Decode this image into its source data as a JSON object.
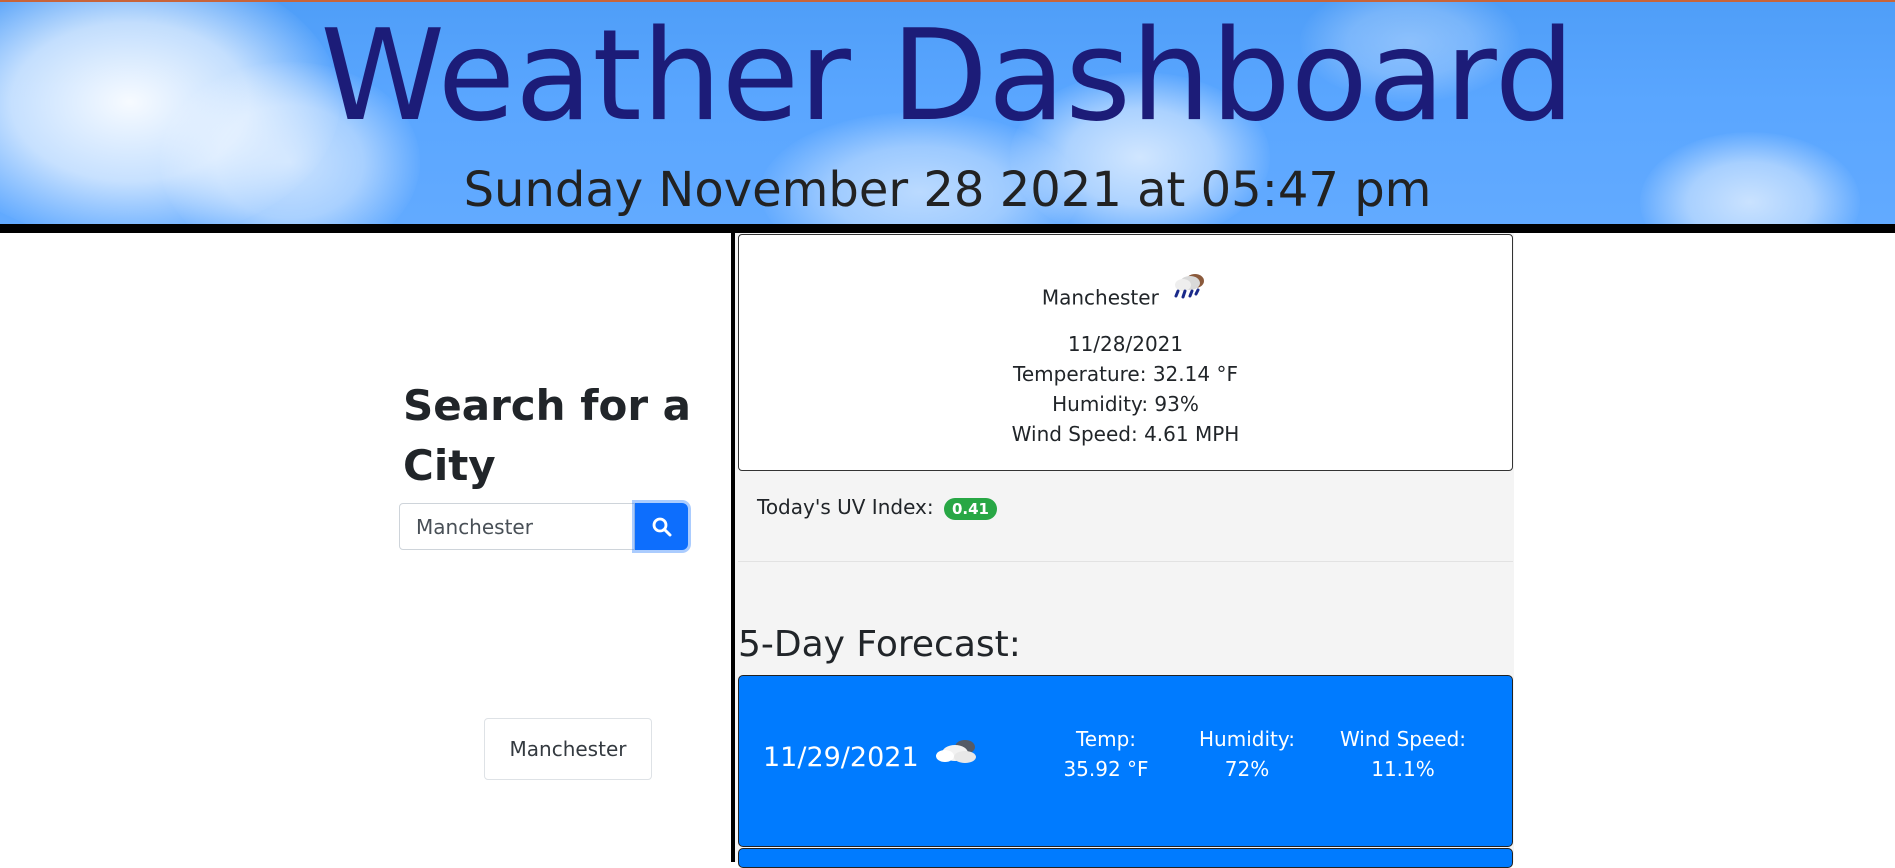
{
  "header": {
    "title": "Weather Dashboard",
    "datetime": "Sunday November 28 2021 at 05:47 pm"
  },
  "search": {
    "heading": "Search for a City",
    "input_value": "Manchester",
    "button_icon": "search-icon",
    "history": [
      "Manchester"
    ]
  },
  "current": {
    "city": "Manchester",
    "icon": "rain-cloud-icon",
    "date": "11/28/2021",
    "temperature": "Temperature: 32.14 °F",
    "humidity": "Humidity: 93%",
    "wind": "Wind Speed: 4.61 MPH",
    "uv_label": "Today's UV Index:",
    "uv_value": "0.41",
    "uv_color": "#28a745"
  },
  "forecast": {
    "heading": "5-Day Forecast:",
    "card_color": "#007bff",
    "days": [
      {
        "date": "11/29/2021",
        "icon": "partly-cloudy-icon",
        "temp_label": "Temp:",
        "temp_value": "35.92 °F",
        "humidity_label": "Humidity:",
        "humidity_value": "72%",
        "wind_label": "Wind Speed:",
        "wind_value": "11.1%"
      },
      {
        "date": "",
        "icon": "",
        "temp_label": "",
        "temp_value": "",
        "humidity_label": "",
        "humidity_value": "",
        "wind_label": "",
        "wind_value": ""
      }
    ]
  },
  "colors": {
    "title_color": "#1c1c78",
    "sky_color": "#5aa6ff",
    "button_blue": "#0d6efd"
  }
}
